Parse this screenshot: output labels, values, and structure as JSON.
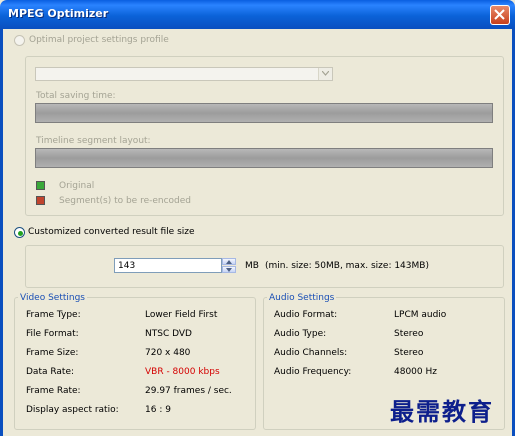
{
  "window": {
    "title": "MPEG Optimizer",
    "accent": "#0a5fe0"
  },
  "optimal": {
    "label": "Optimal project settings profile",
    "selected": false,
    "total_saving_time_label": "Total saving time:",
    "timeline_segment_label": "Timeline segment layout:",
    "legend_original": "Original",
    "legend_reencoded": "Segment(s) to be re-encoded",
    "original_color": "#3aa83a",
    "reencoded_color": "#c0442e"
  },
  "customized": {
    "label": "Customized converted result file size",
    "selected": true,
    "value": "143",
    "unit": "MB",
    "range_note": "(min. size: 50MB, max. size: 143MB)"
  },
  "video_settings": {
    "title": "Video Settings",
    "rows": [
      {
        "label": "Frame Type:",
        "value": "Lower Field First"
      },
      {
        "label": "File Format:",
        "value": "NTSC DVD"
      },
      {
        "label": "Frame Size:",
        "value": "720 x 480"
      },
      {
        "label": "Data Rate:",
        "value": "VBR - 8000 kbps"
      },
      {
        "label": "Frame Rate:",
        "value": "29.97 frames / sec."
      },
      {
        "label": "Display aspect ratio:",
        "value": "16 : 9"
      }
    ]
  },
  "audio_settings": {
    "title": "Audio Settings",
    "rows": [
      {
        "label": "Audio Format:",
        "value": "LPCM audio"
      },
      {
        "label": "Audio Type:",
        "value": "Stereo"
      },
      {
        "label": "Audio Channels:",
        "value": "Stereo"
      },
      {
        "label": "Audio Frequency:",
        "value": "48000 Hz"
      }
    ]
  },
  "watermark": "最需教育"
}
